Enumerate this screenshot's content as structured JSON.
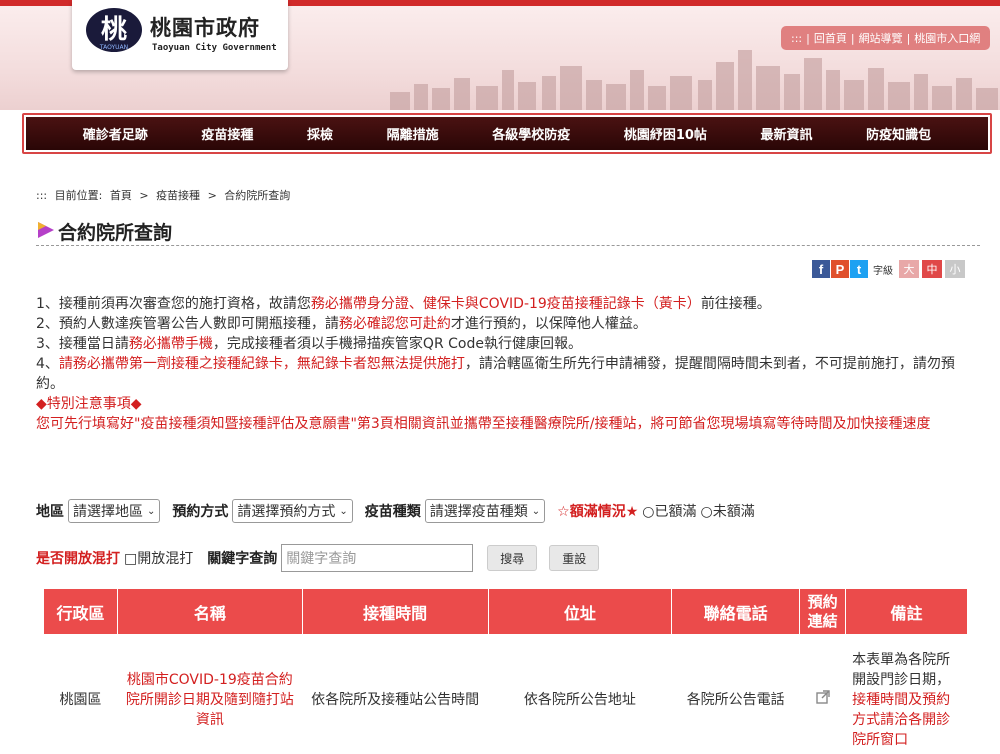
{
  "header": {
    "logo_mark_text": "桃",
    "logo_mark_sub": "TAOYUAN",
    "title": "桃園市政府",
    "subtitle": "Taoyuan City Government",
    "toplinks": [
      ":::",
      "|",
      "回首頁",
      "|",
      "網站導覽",
      "|",
      "桃園市入口網"
    ]
  },
  "nav": [
    "確診者足跡",
    "疫苗接種",
    "採檢",
    "隔離措施",
    "各級學校防疫",
    "桃園紓困10帖",
    "最新資訊",
    "防疫知識包"
  ],
  "breadcrumb": {
    "marker": ":::",
    "label": "目前位置:",
    "items": [
      "首頁",
      ">",
      "疫苗接種",
      ">",
      "合約院所查詢"
    ]
  },
  "page": {
    "title": "合約院所查詢"
  },
  "share": {
    "facebook": "f",
    "plurk": "P",
    "twitter": "t",
    "font_label": "字級",
    "sizes": [
      "大",
      "中",
      "小"
    ]
  },
  "notice": {
    "l1a": "1、接種前須再次審查您的施打資格，故請您",
    "l1b": "務必攜帶身分證、健保卡與COVID-19疫苗接種記錄卡（黃卡）",
    "l1c": "前往接種。",
    "l2a": "2、預約人數達疾管署公告人數即可開瓶接種，請",
    "l2b": "務必確認您可赴約",
    "l2c": "才進行預約，以保障他人權益。",
    "l3a": "3、接種當日請",
    "l3b": "務必攜帶手機",
    "l3c": "，完成接種者須以手機掃描疾管家QR Code執行健康回報。",
    "l4a": "4、",
    "l4b": "請務必攜帶第一劑接種之接種紀錄卡，無紀錄卡者恕無法提供施打",
    "l4c": "，請洽轄區衛生所先行申請補發，提醒間隔時間未到者，不可提前施打，請勿預約。",
    "special_title": "◆特別注意事項◆",
    "special_text": "您可先行填寫好\"疫苗接種須知暨接種評估及意願書\"第3頁相關資訊並攜帶至接種醫療院所/接種站，將可節省您現場填寫等待時間及加快接種速度"
  },
  "filters": {
    "area_label": "地區",
    "area_value": "請選擇地區",
    "method_label": "預約方式",
    "method_value": "請選擇預約方式",
    "vaccine_label": "疫苗種類",
    "vaccine_value": "請選擇疫苗種類",
    "full_label": "☆額滿情況★",
    "full_yes": "○已額滿",
    "full_no": "○未額滿",
    "mix_label": "是否開放混打",
    "mix_option": "□開放混打",
    "kw_label": "關鍵字查詢",
    "kw_placeholder": "關鍵字查詢",
    "search_btn": "搜尋",
    "reset_btn": "重設"
  },
  "table": {
    "headers": [
      "行政區",
      "名稱",
      "接種時間",
      "位址",
      "聯絡電話",
      "預約連結",
      "備註"
    ],
    "rows": [
      {
        "district": "桃園區",
        "name": "桃園市COVID-19疫苗合約院所開診日期及隨到隨打站資訊",
        "time": "依各院所及接種站公告時間",
        "address": "依各院所公告地址",
        "phone": "各院所公告電話",
        "note_a": "本表單為各院所開設門診日期，",
        "note_b": "接種時間及預約方式請洽各開診院所窗口"
      }
    ]
  },
  "colors": {
    "accent_red": "#d32020",
    "table_header": "#eb4b4b",
    "nav_bg": "#3a0c0c"
  }
}
